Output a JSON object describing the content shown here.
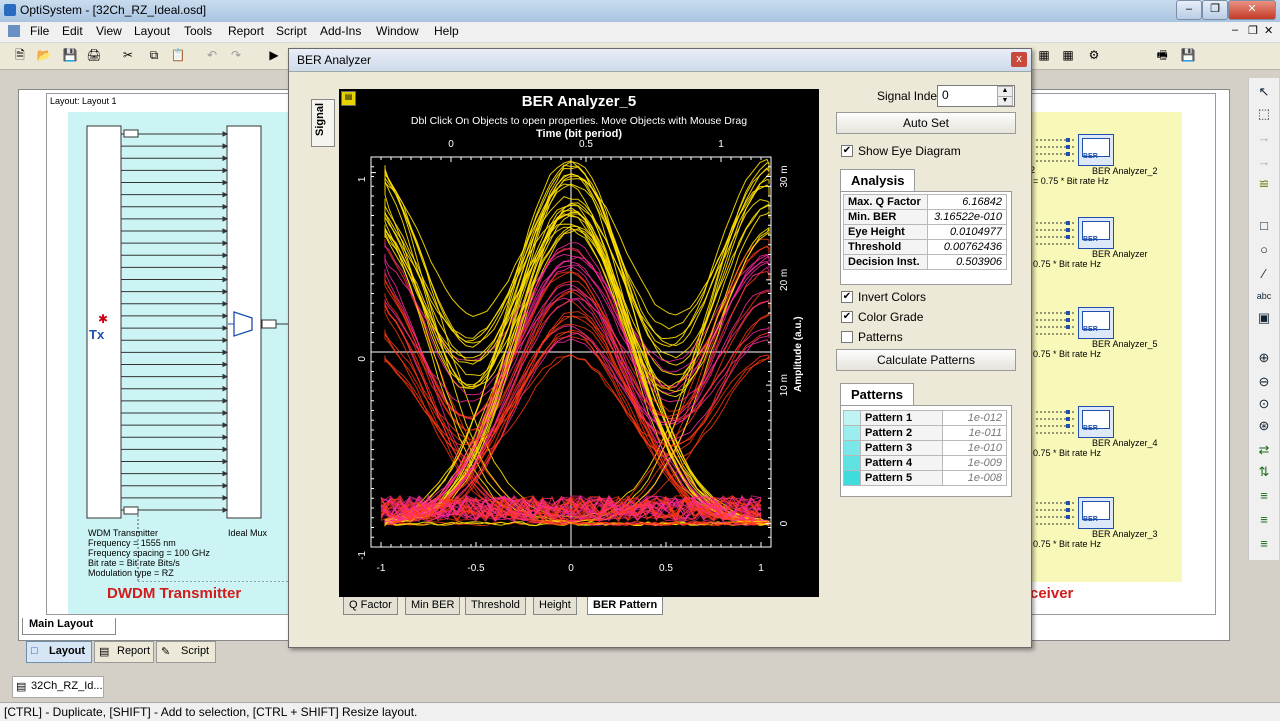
{
  "window": {
    "title": "OptiSystem - [32Ch_RZ_Ideal.osd]"
  },
  "menubar": [
    "File",
    "Edit",
    "View",
    "Layout",
    "Tools",
    "Report",
    "Script",
    "Add-Ins",
    "Window",
    "Help"
  ],
  "layout": {
    "header": "Layout: Layout 1",
    "transmitter": {
      "title": "DWDM Transmitter",
      "tx_label": "Tx",
      "caption_lines": [
        "WDM Transmitter",
        "Frequency = 1555  nm",
        "Frequency spacing = 100  GHz",
        "Bit rate = Bit rate  Bits/s",
        "Modulation type = RZ"
      ],
      "mux_caption": "Ideal Mux"
    },
    "receiver": {
      "title_fragment": "ceiver",
      "analyzers": [
        {
          "name": "BER Analyzer_2",
          "cutoff_prefix": "2",
          "cutoff": "= 0.75 * Bit rate  Hz"
        },
        {
          "name": "BER Analyzer",
          "cutoff_prefix": "",
          "cutoff": "0.75 * Bit rate  Hz"
        },
        {
          "name": "BER Analyzer_5",
          "cutoff_prefix": "",
          "cutoff": "0.75 * Bit rate  Hz"
        },
        {
          "name": "BER Analyzer_4",
          "cutoff_prefix": "",
          "cutoff": "0.75 * Bit rate  Hz"
        },
        {
          "name": "BER Analyzer_3",
          "cutoff_prefix": "",
          "cutoff": "0.75 * Bit rate  Hz"
        }
      ],
      "analyzer_icon_text": "BER"
    },
    "main_tab": "Main Layout",
    "view_tabs": [
      "Layout",
      "Report",
      "Script"
    ],
    "doc_tab": "32Ch_RZ_Id..."
  },
  "dialog": {
    "title": "BER Analyzer",
    "close_glyph": "x",
    "side_tab": "Signal",
    "graph": {
      "title": "BER Analyzer_5",
      "hint": "Dbl Click On Objects to open properties.  Move Objects with Mouse Drag",
      "top_axis_label": "Time (bit period)",
      "top_ticks": [
        "0",
        "0.5",
        "1"
      ],
      "bottom_ticks": [
        "-1",
        "-0.5",
        "0",
        "0.5",
        "1"
      ],
      "left_ticks": [
        "1",
        "0",
        "-1"
      ],
      "right_axis_label": "Amplitude (a.u.)",
      "right_ticks": [
        "30 m",
        "20 m",
        "10 m",
        "0"
      ],
      "tabs": [
        "Q Factor",
        "Min BER",
        "Threshold",
        "Height",
        "BER Pattern"
      ],
      "active_tab": "BER Pattern"
    },
    "signal_index": {
      "label": "Signal Index:",
      "value": "0"
    },
    "auto_set": "Auto Set",
    "show_eye": {
      "label": "Show Eye Diagram",
      "checked": true
    },
    "analysis": {
      "title": "Analysis",
      "rows": [
        {
          "key": "Max. Q Factor",
          "value": "6.16842"
        },
        {
          "key": "Min. BER",
          "value": "3.16522e-010"
        },
        {
          "key": "Eye Height",
          "value": "0.0104977"
        },
        {
          "key": "Threshold",
          "value": "0.00762436"
        },
        {
          "key": "Decision Inst.",
          "value": "0.503906"
        }
      ]
    },
    "invert_colors": {
      "label": "Invert Colors",
      "checked": true
    },
    "color_grade": {
      "label": "Color Grade",
      "checked": true
    },
    "patterns_chk": {
      "label": "Patterns",
      "checked": false
    },
    "calc_patterns": "Calculate Patterns",
    "patterns": {
      "title": "Patterns",
      "rows": [
        {
          "name": "Pattern 1",
          "value": "1e-012"
        },
        {
          "name": "Pattern 2",
          "value": "1e-011"
        },
        {
          "name": "Pattern 3",
          "value": "1e-010"
        },
        {
          "name": "Pattern 4",
          "value": "1e-009"
        },
        {
          "name": "Pattern 5",
          "value": "1e-008"
        }
      ]
    }
  },
  "status": "[CTRL] - Duplicate, [SHIFT] - Add to selection, [CTRL + SHIFT] Resize layout.",
  "colors": {
    "accent_red": "#d21c1c",
    "eye_yellow": "#ffe000",
    "eye_red": "#ff3a10",
    "eye_magenta": "#ff2aa0"
  }
}
